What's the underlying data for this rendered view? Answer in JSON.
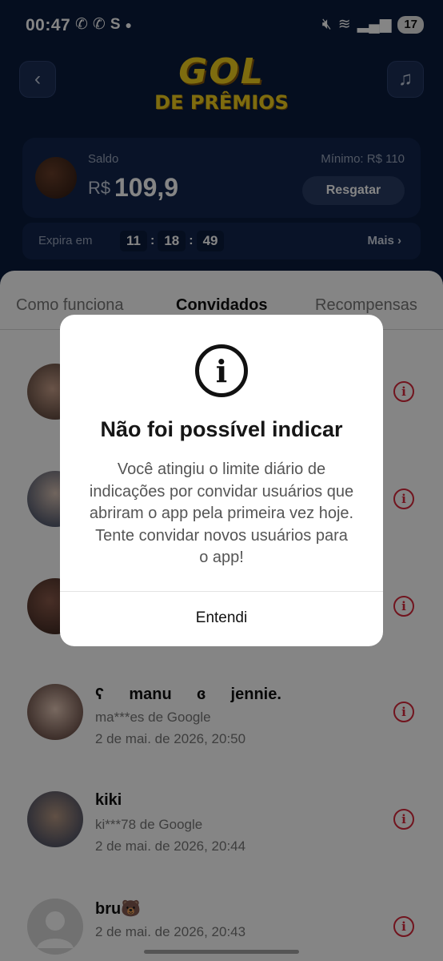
{
  "status_bar": {
    "time": "00:47",
    "left_icons": [
      "whatsapp-icon",
      "whatsapp-business-icon",
      "s-app-icon",
      "dot-icon"
    ],
    "battery": "17"
  },
  "header": {
    "logo_line1": "GOL",
    "logo_line2": "DE PRÊMIOS"
  },
  "balance": {
    "label": "Saldo",
    "currency": "R$",
    "amount": "109,9",
    "minimum_label": "Mínimo: R$ 110",
    "redeem_button": "Resgatar"
  },
  "expiry": {
    "label": "Expira em",
    "hours": "11",
    "minutes": "18",
    "seconds": "49",
    "more_link": "Mais ›"
  },
  "tabs": [
    {
      "label": "Como funciona",
      "active": false
    },
    {
      "label": "Convidados",
      "active": true
    },
    {
      "label": "Recompensas",
      "active": false
    }
  ],
  "invitees": [
    {
      "name": "",
      "sub": "",
      "date": ""
    },
    {
      "name": "",
      "sub": "",
      "date": ""
    },
    {
      "name": "",
      "sub": "",
      "date": ""
    },
    {
      "name": "ʕ⠀⠀manu⠀⠀ɞ⠀⠀jennie.",
      "sub": "ma***es de Google",
      "date": "2 de mai. de 2026, 20:50"
    },
    {
      "name": "kiki",
      "sub": "ki***78 de Google",
      "date": "2 de mai. de 2026, 20:44"
    },
    {
      "name": "bru🐻",
      "sub": "",
      "date": "2 de mai. de 2026, 20:43"
    }
  ],
  "dialog": {
    "title": "Não foi possível indicar",
    "body": "Você atingiu o limite diário de indicações por convidar usuários que abriram o app pela primeira vez hoje. Tente convidar novos usuários para o app!",
    "confirm": "Entendi"
  },
  "colors": {
    "app_bg": "#0b1c3d",
    "logo": "#f2cf1d",
    "info_red": "#d8283b"
  }
}
